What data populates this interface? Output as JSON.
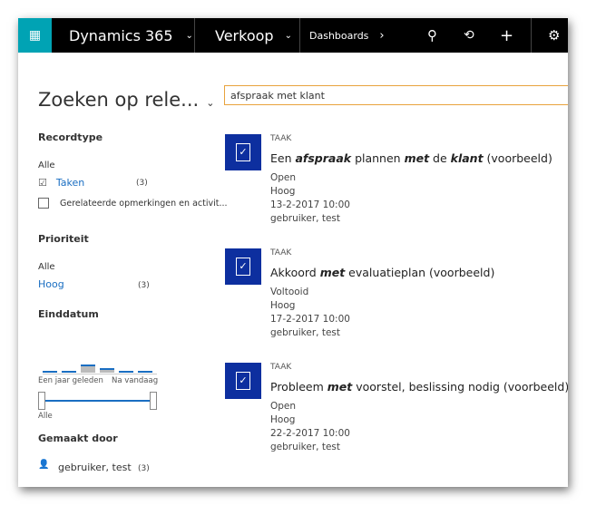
{
  "header": {
    "app": "Dynamics 365",
    "module": "Verkoop",
    "breadcrumb": "Dashboards",
    "icons": [
      "waffle-icon",
      "search-icon",
      "history-icon",
      "plus-icon",
      "gear-icon"
    ]
  },
  "search": {
    "scope": "Zoeken op rele...",
    "value": "afspraak met klant"
  },
  "filters": {
    "recordtype": {
      "title": "Recordtype",
      "all": "Alle",
      "items": [
        {
          "label": "Taken",
          "count": "(3)",
          "checked": true
        },
        {
          "label": "Gerelateerde opmerkingen en activit...",
          "checked": false
        }
      ]
    },
    "priority": {
      "title": "Prioriteit",
      "all": "Alle",
      "items": [
        {
          "label": "Hoog",
          "count": "(3)"
        }
      ]
    },
    "enddate": {
      "title": "Einddatum",
      "from": "Een jaar geleden",
      "to": "Na vandaag",
      "range": "Alle"
    },
    "createdby": {
      "title": "Gemaakt door",
      "items": [
        {
          "label": "gebruiker, test",
          "count": "(3)"
        }
      ]
    }
  },
  "results": [
    {
      "type": "TAAK",
      "title_parts": [
        [
          "Een ",
          ""
        ],
        [
          "afspraak",
          "b"
        ],
        [
          " plannen ",
          ""
        ],
        [
          "met",
          "b"
        ],
        [
          " de ",
          ""
        ],
        [
          "klant",
          "b"
        ],
        [
          " (voorbeeld)",
          ""
        ]
      ],
      "status": "Open",
      "priority": "Hoog",
      "date": "13-2-2017 10:00",
      "owner": "gebruiker, test"
    },
    {
      "type": "TAAK",
      "title_parts": [
        [
          "Akkoord ",
          ""
        ],
        [
          "met",
          "b"
        ],
        [
          " evaluatieplan (voorbeeld)",
          ""
        ]
      ],
      "status": "Voltooid",
      "priority": "Hoog",
      "date": "17-2-2017 10:00",
      "owner": "gebruiker, test"
    },
    {
      "type": "TAAK",
      "title_parts": [
        [
          "Probleem ",
          ""
        ],
        [
          "met",
          "b"
        ],
        [
          " voorstel, beslissing nodig (voorbeeld)",
          ""
        ]
      ],
      "status": "Open",
      "priority": "Hoog",
      "date": "22-2-2017 10:00",
      "owner": "gebruiker, test"
    }
  ],
  "colors": {
    "header": "#000000",
    "waffle": "#00a3b4",
    "accent": "#1a6ec2",
    "task_icon": "#0d2f9f",
    "search_border": "#e8a33d"
  }
}
